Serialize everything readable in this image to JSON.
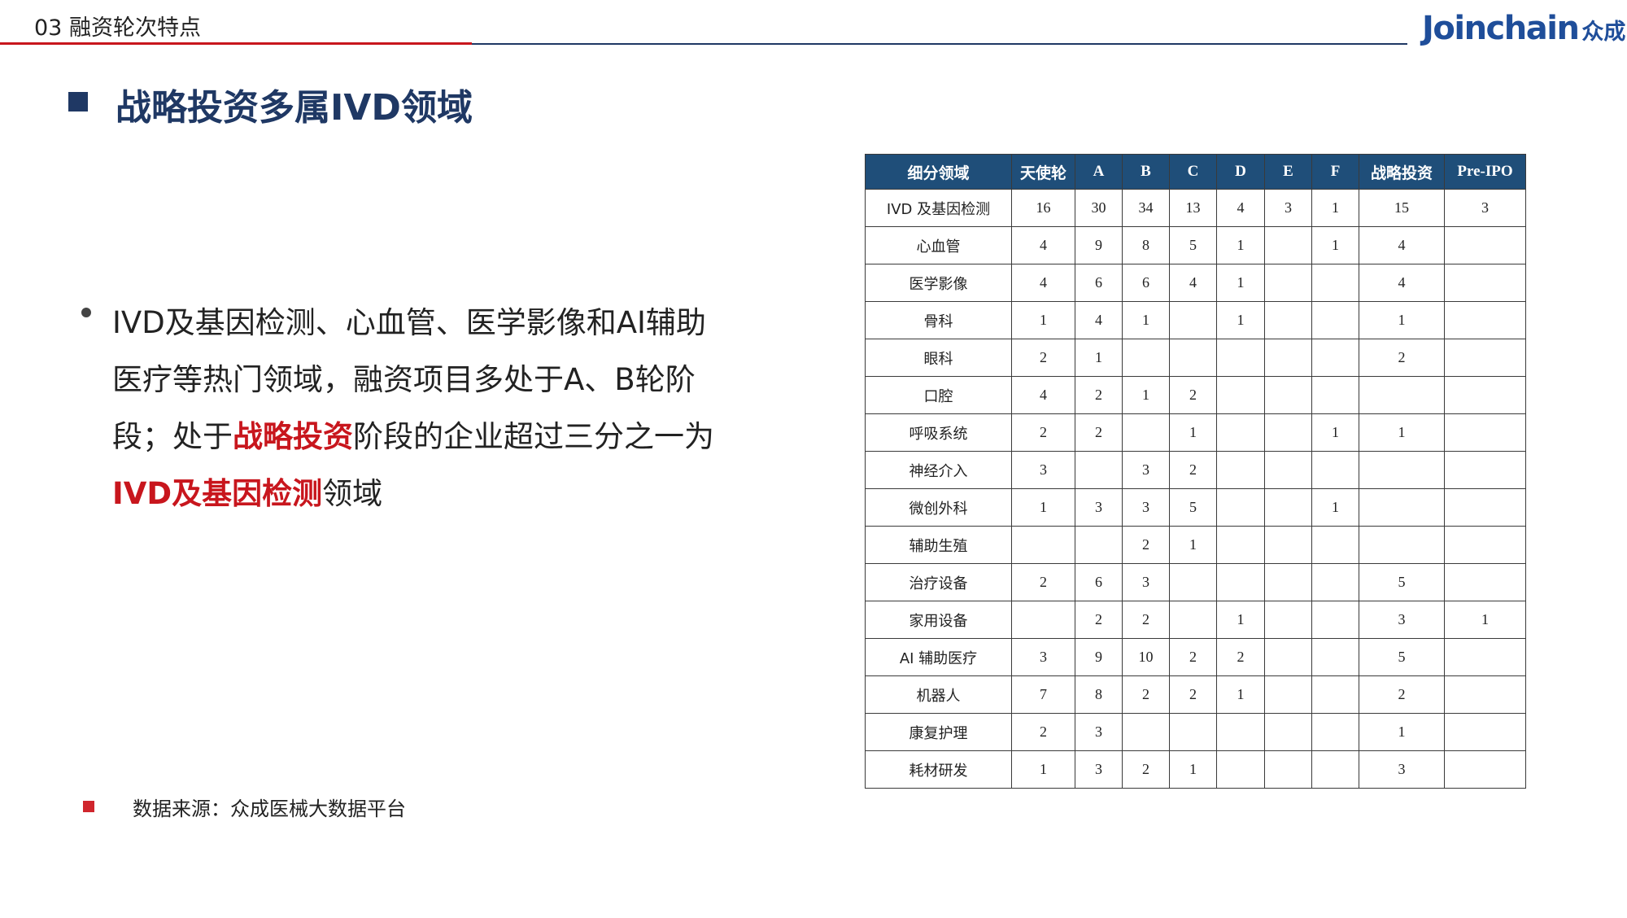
{
  "header": {
    "section_title": "03 融资轮次特点",
    "logo_en": "Joinchain",
    "logo_cn": "众成"
  },
  "heading": "战略投资多属IVD领域",
  "body": {
    "part1": "IVD及基因检测、心血管、医学影像和AI辅助医疗等热门领域，融资项目多处于A、B轮阶段；处于",
    "highlight1": "战略投资",
    "part2": "阶段的企业超过三分之一为",
    "highlight2": "IVD及基因检测",
    "part3": "领域"
  },
  "note": "数据来源：众成医械大数据平台",
  "table": {
    "headers": [
      "细分领域",
      "天使轮",
      "A",
      "B",
      "C",
      "D",
      "E",
      "F",
      "战略投资",
      "Pre-IPO"
    ],
    "rows": [
      [
        "IVD 及基因检测",
        "16",
        "30",
        "34",
        "13",
        "4",
        "3",
        "1",
        "15",
        "3"
      ],
      [
        "心血管",
        "4",
        "9",
        "8",
        "5",
        "1",
        "",
        "1",
        "4",
        ""
      ],
      [
        "医学影像",
        "4",
        "6",
        "6",
        "4",
        "1",
        "",
        "",
        "4",
        ""
      ],
      [
        "骨科",
        "1",
        "4",
        "1",
        "",
        "1",
        "",
        "",
        "1",
        ""
      ],
      [
        "眼科",
        "2",
        "1",
        "",
        "",
        "",
        "",
        "",
        "2",
        ""
      ],
      [
        "口腔",
        "4",
        "2",
        "1",
        "2",
        "",
        "",
        "",
        "",
        ""
      ],
      [
        "呼吸系统",
        "2",
        "2",
        "",
        "1",
        "",
        "",
        "1",
        "1",
        ""
      ],
      [
        "神经介入",
        "3",
        "",
        "3",
        "2",
        "",
        "",
        "",
        "",
        ""
      ],
      [
        "微创外科",
        "1",
        "3",
        "3",
        "5",
        "",
        "",
        "1",
        "",
        ""
      ],
      [
        "辅助生殖",
        "",
        "",
        "2",
        "1",
        "",
        "",
        "",
        "",
        ""
      ],
      [
        "治疗设备",
        "2",
        "6",
        "3",
        "",
        "",
        "",
        "",
        "5",
        ""
      ],
      [
        "家用设备",
        "",
        "2",
        "2",
        "",
        "1",
        "",
        "",
        "3",
        "1"
      ],
      [
        "AI 辅助医疗",
        "3",
        "9",
        "10",
        "2",
        "2",
        "",
        "",
        "5",
        ""
      ],
      [
        "机器人",
        "7",
        "8",
        "2",
        "2",
        "1",
        "",
        "",
        "2",
        ""
      ],
      [
        "康复护理",
        "2",
        "3",
        "",
        "",
        "",
        "",
        "",
        "1",
        ""
      ],
      [
        "耗材研发",
        "1",
        "3",
        "2",
        "1",
        "",
        "",
        "",
        "3",
        ""
      ]
    ]
  },
  "colors": {
    "accent_red": "#c8161d",
    "navy": "#1f3864",
    "table_header": "#1f4e79",
    "logo_blue": "#1f4e9a"
  }
}
